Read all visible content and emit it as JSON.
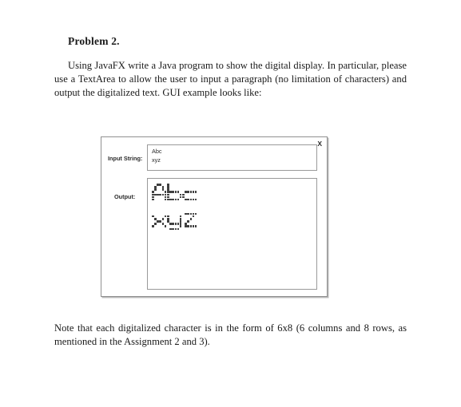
{
  "document": {
    "heading": "Problem 2.",
    "paragraph": "Using JavaFX write a Java program to show the digital display. In particular, please use a TextArea to allow the user to input a paragraph (no limitation of characters) and output the digitalized text. GUI example looks like:",
    "note": "Note that each digitalized character is in the form of 6x8 (6 columns and 8 rows, as mentioned in the Assignment 2 and 3)."
  },
  "gui": {
    "close_label": "X",
    "input": {
      "label": "Input String:",
      "lines": [
        "Abc",
        "xyz"
      ],
      "placeholder": ""
    },
    "output": {
      "label": "Output:",
      "lines": [
        "Abc",
        "xyz"
      ]
    }
  },
  "colors": {
    "frame_border": "#909090",
    "field_border": "#9a9a9a",
    "dot": "#3d3d3d",
    "text": "#2b2b2b",
    "background": "#ffffff"
  },
  "matrix": {
    "grid": {
      "columns": 6,
      "rows": 8
    },
    "glyphs": {
      "A": [
        [
          0,
          0,
          1,
          1,
          0,
          0
        ],
        [
          0,
          1,
          0,
          0,
          1,
          0
        ],
        [
          0,
          1,
          0,
          0,
          1,
          0
        ],
        [
          1,
          0,
          0,
          0,
          0,
          1
        ],
        [
          1,
          1,
          1,
          1,
          1,
          1
        ],
        [
          1,
          0,
          0,
          0,
          0,
          1
        ],
        [
          1,
          0,
          0,
          0,
          0,
          1
        ],
        [
          0,
          0,
          0,
          0,
          0,
          0
        ]
      ],
      "b": [
        [
          1,
          0,
          0,
          0,
          0,
          0
        ],
        [
          1,
          0,
          0,
          0,
          0,
          0
        ],
        [
          1,
          0,
          0,
          0,
          0,
          0
        ],
        [
          1,
          1,
          1,
          1,
          1,
          0
        ],
        [
          1,
          0,
          0,
          0,
          0,
          1
        ],
        [
          1,
          0,
          0,
          0,
          0,
          1
        ],
        [
          1,
          1,
          1,
          1,
          1,
          0
        ],
        [
          0,
          0,
          0,
          0,
          0,
          0
        ]
      ],
      "c": [
        [
          0,
          0,
          0,
          0,
          0,
          0
        ],
        [
          0,
          0,
          0,
          0,
          0,
          0
        ],
        [
          0,
          0,
          0,
          0,
          0,
          0
        ],
        [
          0,
          1,
          1,
          1,
          1,
          1
        ],
        [
          1,
          0,
          0,
          0,
          0,
          0
        ],
        [
          1,
          0,
          0,
          0,
          0,
          0
        ],
        [
          0,
          1,
          1,
          1,
          1,
          1
        ],
        [
          0,
          0,
          0,
          0,
          0,
          0
        ]
      ],
      "x": [
        [
          0,
          0,
          0,
          0,
          0,
          0
        ],
        [
          0,
          0,
          0,
          0,
          0,
          0
        ],
        [
          1,
          0,
          0,
          0,
          0,
          1
        ],
        [
          0,
          1,
          0,
          0,
          1,
          0
        ],
        [
          0,
          0,
          1,
          1,
          0,
          0
        ],
        [
          0,
          1,
          0,
          0,
          1,
          0
        ],
        [
          1,
          0,
          0,
          0,
          0,
          1
        ],
        [
          0,
          0,
          0,
          0,
          0,
          0
        ]
      ],
      "y": [
        [
          0,
          0,
          0,
          0,
          0,
          0
        ],
        [
          0,
          0,
          0,
          0,
          0,
          0
        ],
        [
          1,
          0,
          0,
          0,
          0,
          1
        ],
        [
          1,
          0,
          0,
          0,
          0,
          1
        ],
        [
          1,
          0,
          0,
          0,
          0,
          1
        ],
        [
          0,
          1,
          1,
          1,
          1,
          1
        ],
        [
          0,
          0,
          0,
          0,
          0,
          1
        ],
        [
          0,
          1,
          1,
          1,
          1,
          0
        ]
      ],
      "z": [
        [
          0,
          0,
          0,
          0,
          0,
          0
        ],
        [
          0,
          1,
          1,
          1,
          1,
          1
        ],
        [
          0,
          0,
          0,
          0,
          1,
          0
        ],
        [
          0,
          0,
          0,
          1,
          0,
          0
        ],
        [
          0,
          0,
          1,
          0,
          0,
          0
        ],
        [
          0,
          1,
          0,
          0,
          0,
          0
        ],
        [
          0,
          1,
          1,
          1,
          1,
          1
        ],
        [
          0,
          0,
          0,
          0,
          0,
          0
        ]
      ]
    }
  }
}
